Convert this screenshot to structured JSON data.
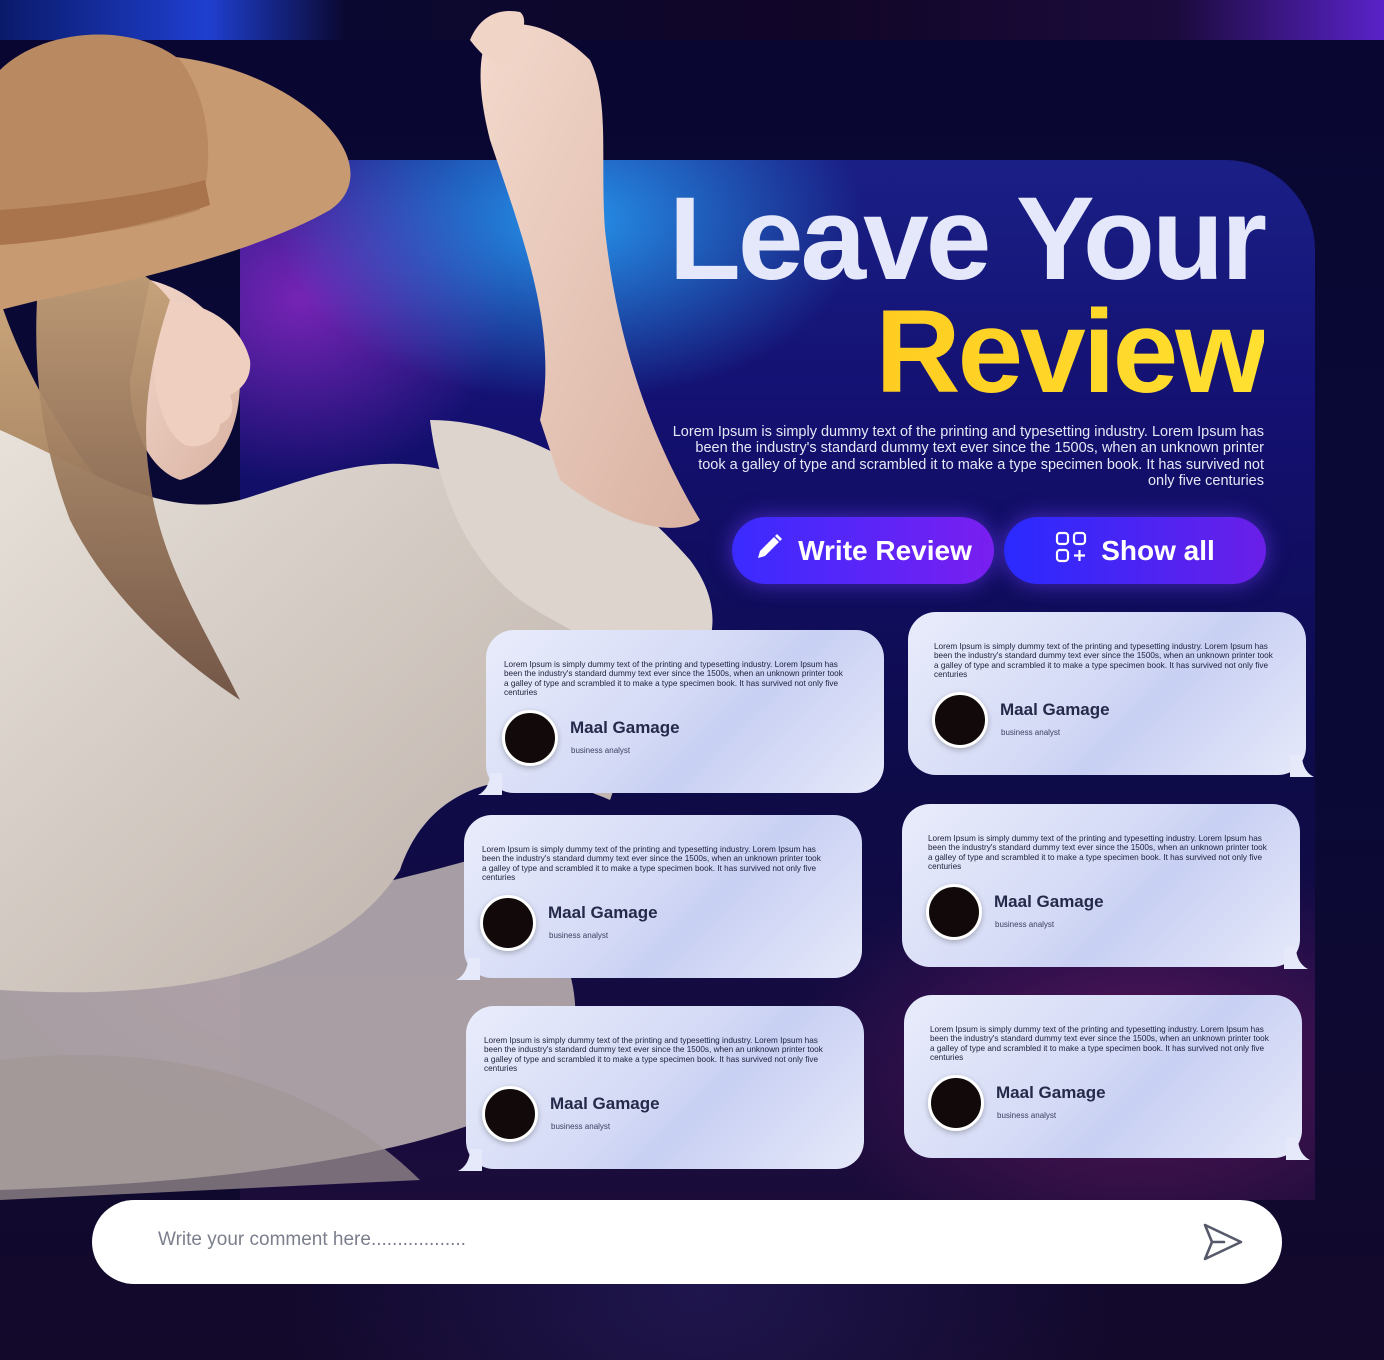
{
  "hero": {
    "title_line1": "Leave Your",
    "title_line2": "Review",
    "description": "Lorem Ipsum is simply dummy text of the printing and typesetting industry. Lorem Ipsum has been the industry's standard dummy text ever since the 1500s, when an unknown printer took a galley of type and scrambled it to make a type specimen book. It has survived not only five centuries"
  },
  "actions": {
    "write_review_label": "Write Review",
    "show_all_label": "Show all"
  },
  "reviews": [
    {
      "text": "Lorem Ipsum is simply dummy text of the printing and typesetting industry. Lorem Ipsum has been the industry's standard dummy text ever since the 1500s, when an unknown printer took a galley of type and scrambled it to make a type specimen book. It has survived not only five centuries",
      "name": "Maal Gamage",
      "role": "business analyst"
    },
    {
      "text": "Lorem Ipsum is simply dummy text of the printing and typesetting industry. Lorem Ipsum has been the industry's standard dummy text ever since the 1500s, when an unknown printer took a galley of type and scrambled it to make a type specimen book. It has survived not only five centuries",
      "name": "Maal Gamage",
      "role": "business analyst"
    },
    {
      "text": "Lorem Ipsum is simply dummy text of the printing and typesetting industry. Lorem Ipsum has been the industry's standard dummy text ever since the 1500s, when an unknown printer took a galley of type and scrambled it to make a type specimen book. It has survived not only five centuries",
      "name": "Maal Gamage",
      "role": "business analyst"
    },
    {
      "text": "Lorem Ipsum is simply dummy text of the printing and typesetting industry. Lorem Ipsum has been the industry's standard dummy text ever since the 1500s, when an unknown printer took a galley of type and scrambled it to make a type specimen book. It has survived not only five centuries",
      "name": "Maal Gamage",
      "role": "business analyst"
    },
    {
      "text": "Lorem Ipsum is simply dummy text of the printing and typesetting industry. Lorem Ipsum has been the industry's standard dummy text ever since the 1500s, when an unknown printer took a galley of type and scrambled it to make a type specimen book. It has survived not only five centuries",
      "name": "Maal Gamage",
      "role": "business analyst"
    },
    {
      "text": "Lorem Ipsum is simply dummy text of the printing and typesetting industry. Lorem Ipsum has been the industry's standard dummy text ever since the 1500s, when an unknown printer took a galley of type and scrambled it to make a type specimen book. It has survived not only five centuries",
      "name": "Maal Gamage",
      "role": "business analyst"
    }
  ],
  "comment": {
    "placeholder": "Write your comment here.................."
  },
  "icons": {
    "write": "pencil-icon",
    "show_all": "grid-plus-icon",
    "send": "send-icon"
  },
  "colors": {
    "title_primary": "#e4e8fa",
    "title_accent": "#ffc21a",
    "button_gradient_start": "#3a2bff",
    "button_gradient_end": "#7a1ff0",
    "card_bg": "#e2e6f8",
    "background": "#0b0a2e"
  }
}
